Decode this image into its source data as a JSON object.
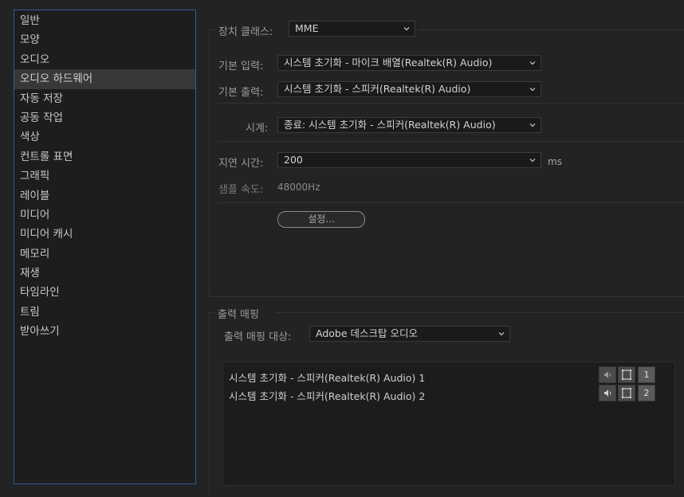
{
  "sidebar": {
    "items": [
      {
        "label": "일반"
      },
      {
        "label": "모양"
      },
      {
        "label": "오디오"
      },
      {
        "label": "오디오 하드웨어",
        "selected": true
      },
      {
        "label": "자동 저장"
      },
      {
        "label": "공동 작업"
      },
      {
        "label": "색상"
      },
      {
        "label": "컨트롤 표면"
      },
      {
        "label": "그래픽"
      },
      {
        "label": "레이블"
      },
      {
        "label": "미디어"
      },
      {
        "label": "미디어 캐시"
      },
      {
        "label": "메모리"
      },
      {
        "label": "재생"
      },
      {
        "label": "타임라인"
      },
      {
        "label": "트림"
      },
      {
        "label": "받아쓰기"
      }
    ]
  },
  "device": {
    "class_label": "장치 클래스:",
    "class_value": "MME",
    "input_label": "기본 입력:",
    "input_value": "시스템 초기화 - 마이크 배열(Realtek(R) Audio)",
    "output_label": "기본 출력:",
    "output_value": "시스템 초기화 - 스피커(Realtek(R) Audio)",
    "clock_label": "시계:",
    "clock_value": "종료: 시스템 초기화 - 스피커(Realtek(R) Audio)",
    "latency_label": "지연 시간:",
    "latency_value": "200",
    "latency_unit": "ms",
    "sample_rate_label": "샘플 속도:",
    "sample_rate_value": "48000Hz",
    "settings_button": "설정..."
  },
  "output_mapping": {
    "section_title": "출력 매핑",
    "target_label": "출력 매핑 대상:",
    "target_value": "Adobe 데스크탑 오디오",
    "rows": [
      {
        "label": "시스템 초기화 - 스피커(Realtek(R) Audio) 1",
        "channel": "1"
      },
      {
        "label": "시스템 초기화 - 스피커(Realtek(R) Audio) 2",
        "channel": "2"
      }
    ]
  }
}
